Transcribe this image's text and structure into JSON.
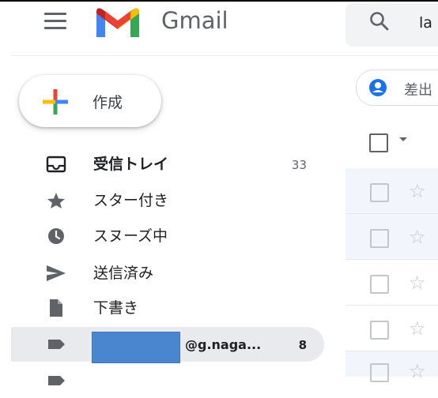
{
  "app": {
    "brand": "Gmail"
  },
  "header": {
    "search_value": "la"
  },
  "compose": {
    "label": "作成"
  },
  "nav": {
    "items": [
      {
        "label": "受信トレイ",
        "count": "33",
        "icon": "inbox-icon"
      },
      {
        "label": "スター付き",
        "count": "",
        "icon": "star-icon"
      },
      {
        "label": "スヌーズ中",
        "count": "",
        "icon": "clock-icon"
      },
      {
        "label": "送信済み",
        "count": "",
        "icon": "send-icon"
      },
      {
        "label": "下書き",
        "count": "",
        "icon": "draft-icon"
      },
      {
        "label": "@g.naga...",
        "count": "8",
        "icon": "label-icon"
      }
    ]
  },
  "main": {
    "filter_chip": "差出"
  },
  "colors": {
    "brand_red": "#ea4335",
    "brand_blue": "#4285f4",
    "brand_green": "#34a853",
    "brand_yellow": "#fbbc04",
    "active_bg": "#e8eaed",
    "redaction": "#4a86cf"
  }
}
